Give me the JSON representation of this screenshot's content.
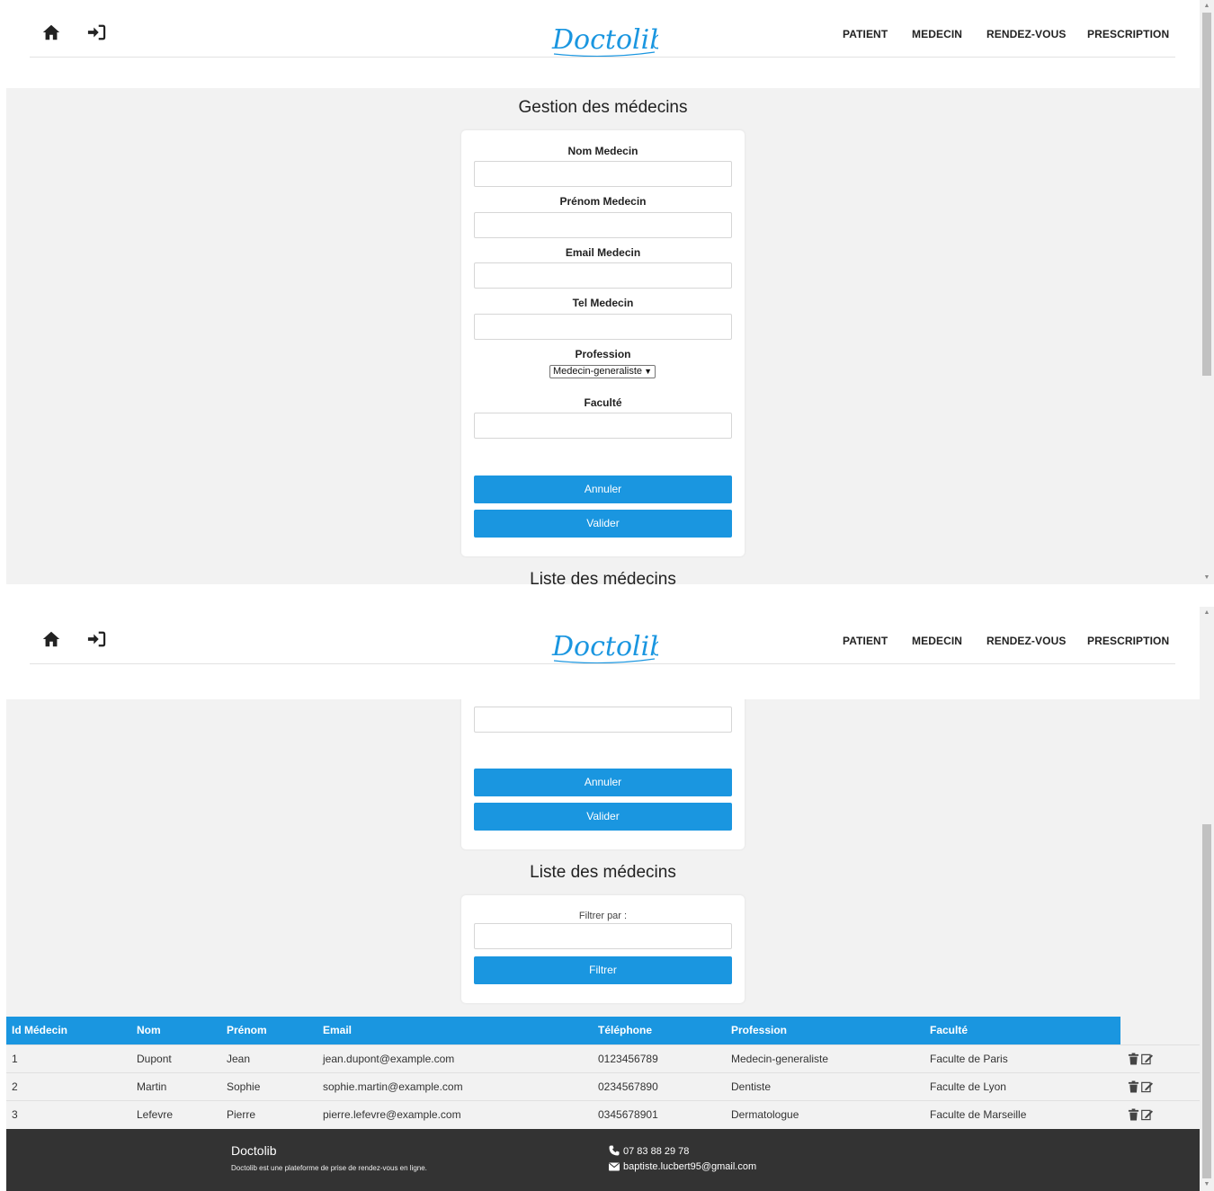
{
  "header": {
    "logo": "Doctolib",
    "nav": [
      "PATIENT",
      "MEDECIN",
      "RENDEZ-VOUS",
      "PRESCRIPTION"
    ]
  },
  "form": {
    "title": "Gestion des médecins",
    "fields": {
      "nom": "Nom Medecin",
      "prenom": "Prénom Medecin",
      "email": "Email Medecin",
      "tel": "Tel Medecin",
      "profession": "Profession",
      "faculte": "Faculté"
    },
    "profession_selected": "Medecin-generaliste",
    "cancel_label": "Annuler",
    "submit_label": "Valider"
  },
  "list": {
    "title": "Liste des médecins",
    "filter_label": "Filtrer par :",
    "filter_button": "Filtrer",
    "columns": [
      "Id Médecin",
      "Nom",
      "Prénom",
      "Email",
      "Téléphone",
      "Profession",
      "Faculté"
    ],
    "rows": [
      [
        "1",
        "Dupont",
        "Jean",
        "jean.dupont@example.com",
        "0123456789",
        "Medecin-generaliste",
        "Faculte de Paris"
      ],
      [
        "2",
        "Martin",
        "Sophie",
        "sophie.martin@example.com",
        "0234567890",
        "Dentiste",
        "Faculte de Lyon"
      ],
      [
        "3",
        "Lefevre",
        "Pierre",
        "pierre.lefevre@example.com",
        "0345678901",
        "Dermatologue",
        "Faculte de Marseille"
      ]
    ]
  },
  "footer": {
    "title": "Doctolib",
    "description": "Doctolib est une plateforme de prise de rendez-vous en ligne.",
    "phone": "07 83 88 29 78",
    "email": "baptiste.lucbert95@gmail.com"
  },
  "icons": {
    "home": "home-icon",
    "login": "login-icon",
    "delete": "trash-icon",
    "edit": "edit-icon",
    "phone": "phone-icon",
    "mail": "envelope-icon"
  },
  "colors": {
    "primary": "#1a96e0",
    "background": "#f2f2f2",
    "footer": "#333333"
  }
}
